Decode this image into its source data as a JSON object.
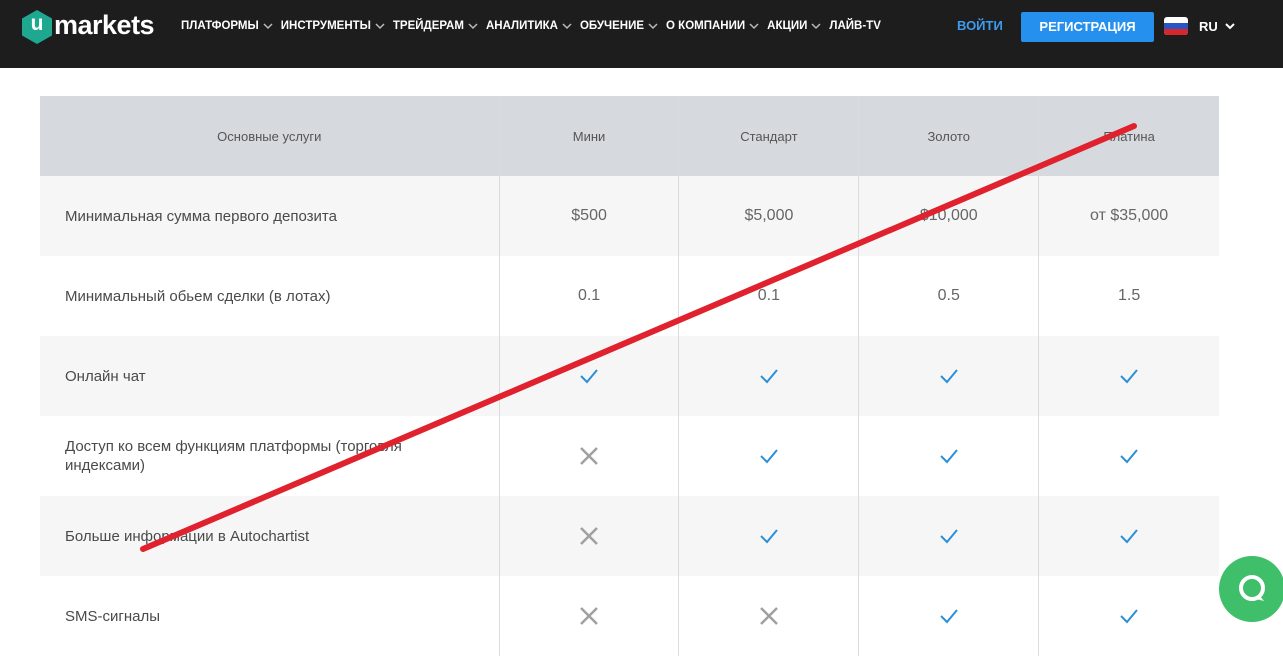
{
  "header": {
    "logo_letter": "u",
    "logo_text": "markets",
    "nav": [
      {
        "label": "ПЛАТФОРМЫ",
        "has_dropdown": true
      },
      {
        "label": "ИНСТРУМЕНТЫ",
        "has_dropdown": true
      },
      {
        "label": "ТРЕЙДЕРАМ",
        "has_dropdown": true
      },
      {
        "label": "АНАЛИТИКА",
        "has_dropdown": true
      },
      {
        "label": "ОБУЧЕНИЕ",
        "has_dropdown": true
      },
      {
        "label": "О КОМПАНИИ",
        "has_dropdown": true
      },
      {
        "label": "АКЦИИ",
        "has_dropdown": true
      },
      {
        "label": "ЛАЙВ-TV",
        "has_dropdown": false
      }
    ],
    "login_label": "ВОЙТИ",
    "register_label": "РЕГИСТРАЦИЯ",
    "language": "RU",
    "flag_icon": "russia-flag-icon"
  },
  "colors": {
    "accent": "#2590ee",
    "login": "#3d9bf0",
    "check": "#2b8fd6",
    "cross": "#a0a0a0",
    "strike": "#e0212e",
    "chat": "#3fbf6a"
  },
  "table": {
    "headers": [
      "Основные услуги",
      "Мини",
      "Стандарт",
      "Золото",
      "Платина"
    ],
    "rows": [
      {
        "label": "Минимальная сумма первого депозита",
        "values": [
          "$500",
          "$5,000",
          "$10,000",
          "от $35,000"
        ]
      },
      {
        "label": "Минимальный обьем сделки (в лотах)",
        "values": [
          "0.1",
          "0.1",
          "0.5",
          "1.5"
        ]
      },
      {
        "label": "Онлайн чат",
        "values": [
          "check",
          "check",
          "check",
          "check"
        ]
      },
      {
        "label": "Доступ ко всем функциям платформы (торговля индексами)",
        "values": [
          "cross",
          "check",
          "check",
          "check"
        ]
      },
      {
        "label": "Больше информации в Autochartist",
        "values": [
          "cross",
          "check",
          "check",
          "check"
        ]
      },
      {
        "label": "SMS-сигналы",
        "values": [
          "cross",
          "cross",
          "check",
          "check"
        ]
      }
    ]
  },
  "chat_icon": "chat-bubble-icon"
}
